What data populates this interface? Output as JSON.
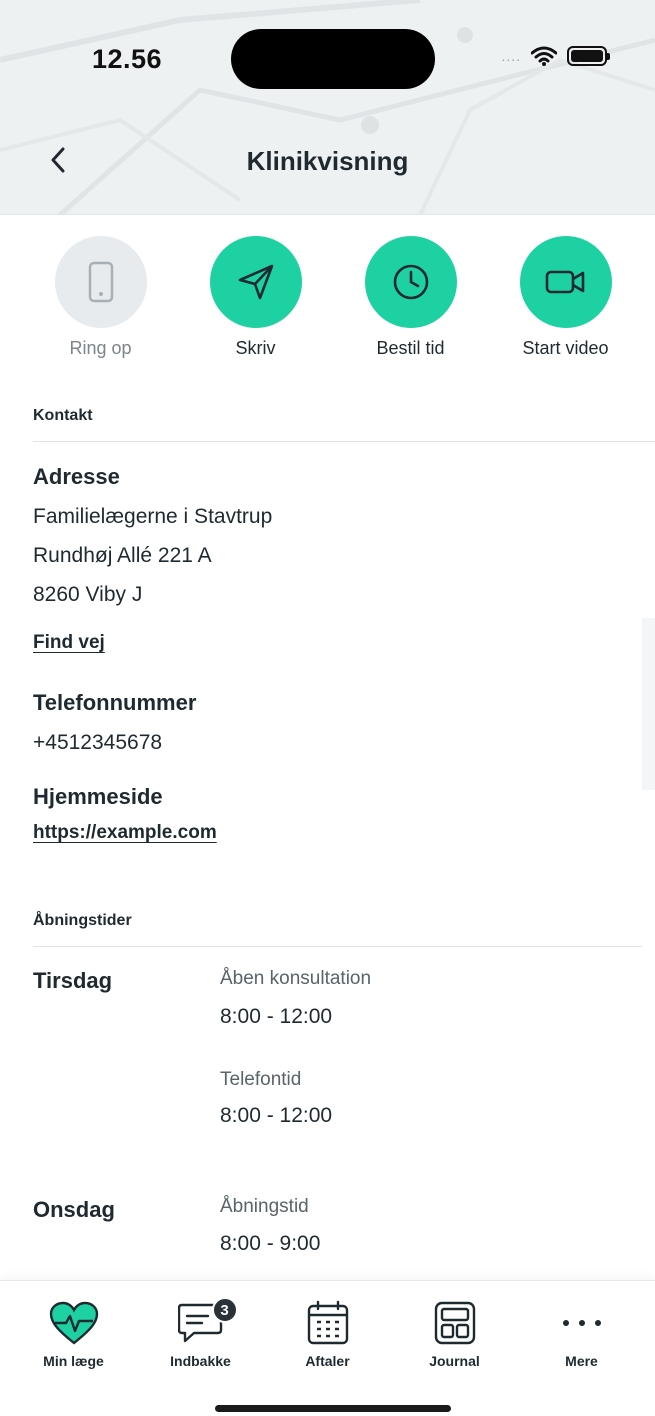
{
  "status_bar": {
    "time": "12.56",
    "signal": "...."
  },
  "header": {
    "title": "Klinikvisning"
  },
  "actions": [
    {
      "label": "Ring op",
      "icon": "phone-icon",
      "enabled": false
    },
    {
      "label": "Skriv",
      "icon": "send-icon",
      "enabled": true
    },
    {
      "label": "Bestil tid",
      "icon": "clock-icon",
      "enabled": true
    },
    {
      "label": "Start video",
      "icon": "video-icon",
      "enabled": true
    }
  ],
  "contact": {
    "section_label": "Kontakt",
    "address_heading": "Adresse",
    "address_lines": [
      "Familielægerne i Stavtrup",
      "Rundhøj Allé 221 A",
      "8260 Viby J"
    ],
    "directions_link": "Find vej",
    "phone_heading": "Telefonnummer",
    "phone": "+4512345678",
    "website_heading": "Hjemmeside",
    "website": "https://example.com"
  },
  "opening_hours": {
    "section_label": "Åbningstider",
    "days": [
      {
        "day": "Tirsdag",
        "slots": [
          {
            "label": "Åben konsultation",
            "time": "8:00 - 12:00"
          },
          {
            "label": "Telefontid",
            "time": "8:00 - 12:00"
          }
        ]
      },
      {
        "day": "Onsdag",
        "slots": [
          {
            "label": "Åbningstid",
            "time": "8:00 - 9:00"
          }
        ]
      }
    ]
  },
  "tabbar": {
    "tabs": [
      {
        "label": "Min læge",
        "icon": "heart-pulse-icon",
        "active": true
      },
      {
        "label": "Indbakke",
        "icon": "chat-icon",
        "badge": "3"
      },
      {
        "label": "Aftaler",
        "icon": "calendar-icon"
      },
      {
        "label": "Journal",
        "icon": "journal-icon"
      },
      {
        "label": "Mere",
        "icon": "more-icon"
      }
    ]
  },
  "colors": {
    "accent": "#1ed1a2",
    "text": "#1f2a30",
    "disabled": "#e8ebed"
  }
}
